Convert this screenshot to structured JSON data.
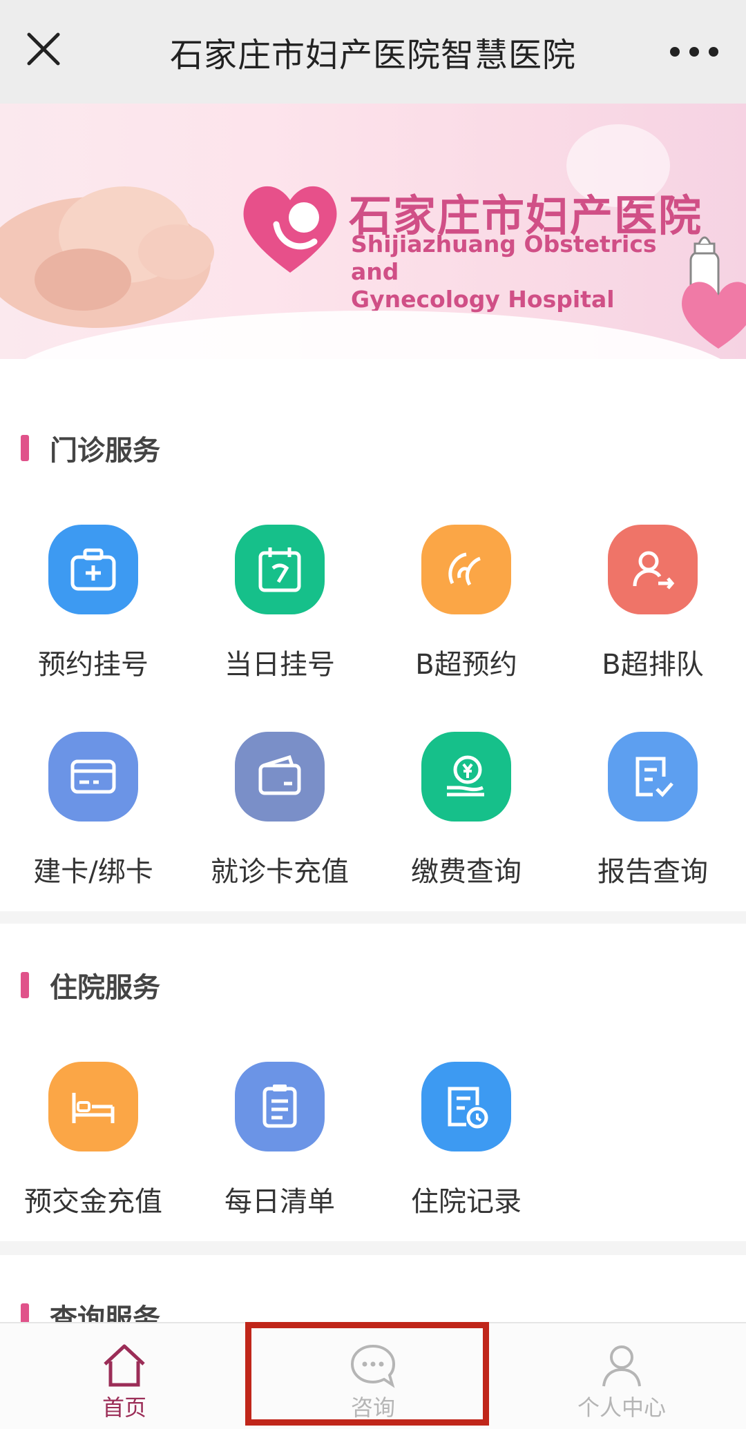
{
  "header": {
    "title": "石家庄市妇产医院智慧医院"
  },
  "banner": {
    "name_cn": "石家庄市妇产医院",
    "name_en_line1": "Shijiazhuang Obstetrics and",
    "name_en_line2": "Gynecology Hospital"
  },
  "outpatient": {
    "title": "门诊服务",
    "items": [
      {
        "label": "预约挂号",
        "icon": "medical-kit-icon",
        "color": "#3d9af2"
      },
      {
        "label": "当日挂号",
        "icon": "calendar-icon",
        "color": "#16c08a"
      },
      {
        "label": "B超预约",
        "icon": "ultrasound-icon",
        "color": "#fba646"
      },
      {
        "label": "B超排队",
        "icon": "queue-icon",
        "color": "#ef7468"
      },
      {
        "label": "建卡/绑卡",
        "icon": "card-icon",
        "color": "#6b94e6"
      },
      {
        "label": "就诊卡充值",
        "icon": "wallet-icon",
        "color": "#7a8fc8"
      },
      {
        "label": "缴费查询",
        "icon": "payment-icon",
        "color": "#16c08a"
      },
      {
        "label": "报告查询",
        "icon": "report-icon",
        "color": "#5d9ff0"
      }
    ]
  },
  "inpatient": {
    "title": "住院服务",
    "items": [
      {
        "label": "预交金充值",
        "icon": "bed-icon",
        "color": "#fba646"
      },
      {
        "label": "每日清单",
        "icon": "clipboard-icon",
        "color": "#6b94e6"
      },
      {
        "label": "住院记录",
        "icon": "record-icon",
        "color": "#3d9af2"
      }
    ]
  },
  "query": {
    "title": "查询服务"
  },
  "tabbar": {
    "home": "首页",
    "consult": "咨询",
    "profile": "个人中心",
    "active_color": "#9b2d57",
    "inactive_color": "#b5b5b5"
  }
}
